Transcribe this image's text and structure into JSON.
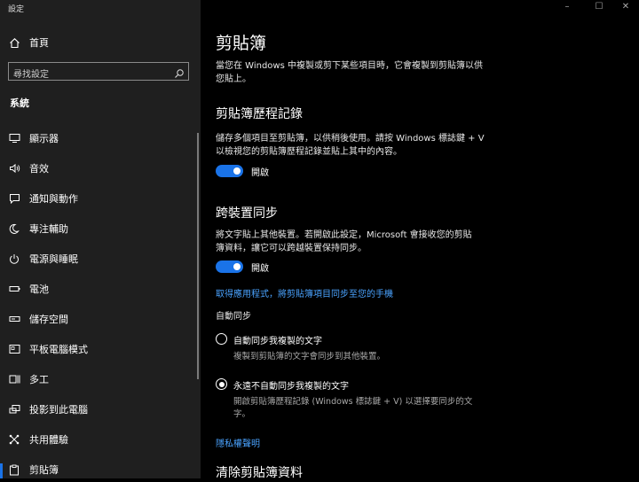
{
  "window": {
    "title": "設定",
    "min": "–",
    "max": "☐",
    "close": "✕"
  },
  "sidebar": {
    "home_label": "首頁",
    "search_placeholder": "尋找設定",
    "section_title": "系統",
    "items": [
      {
        "label": "顯示器",
        "icon": "display-icon"
      },
      {
        "label": "音效",
        "icon": "speaker-icon"
      },
      {
        "label": "通知與動作",
        "icon": "notification-icon"
      },
      {
        "label": "專注輔助",
        "icon": "moon-icon"
      },
      {
        "label": "電源與睡眠",
        "icon": "power-icon"
      },
      {
        "label": "電池",
        "icon": "battery-icon"
      },
      {
        "label": "儲存空間",
        "icon": "storage-icon"
      },
      {
        "label": "平板電腦模式",
        "icon": "tablet-icon"
      },
      {
        "label": "多工",
        "icon": "multitask-icon"
      },
      {
        "label": "投影到此電腦",
        "icon": "project-icon"
      },
      {
        "label": "共用體驗",
        "icon": "shared-icon"
      },
      {
        "label": "剪貼簿",
        "icon": "clipboard-icon"
      }
    ]
  },
  "main": {
    "title": "剪貼簿",
    "intro_line1": "當您在 Windows 中複製或剪下某些項目時，它會複製到剪貼簿以供",
    "intro_line2": "您貼上。",
    "history": {
      "heading": "剪貼簿歷程記錄",
      "desc_line1": "儲存多個項目至剪貼簿，以供稍後使用。請按 Windows 標誌鍵 + V",
      "desc_line2": "以檢視您的剪貼簿歷程記錄並貼上其中的內容。",
      "toggle_label": "開啟"
    },
    "sync": {
      "heading": "跨裝置同步",
      "desc_line1": "將文字貼上其他裝置。若開啟此設定，Microsoft 會接收您的剪貼",
      "desc_line2": "簿資料，讓它可以跨越裝置保持同步。",
      "toggle_label": "開啟",
      "link": "取得應用程式，將剪貼簿項目同步至您的手機",
      "auto_sync_label": "自動同步",
      "option1_label": "自動同步我複製的文字",
      "option1_desc": "複製到剪貼簿的文字會同步到其他裝置。",
      "option2_label": "永遠不自動同步我複製的文字",
      "option2_desc_line1": "開啟剪貼簿歷程記錄 (Windows 標誌鍵 + V) 以選擇要同步的文",
      "option2_desc_line2": "字。",
      "privacy_link": "隱私權聲明"
    },
    "clear_heading": "清除剪貼簿資料"
  }
}
